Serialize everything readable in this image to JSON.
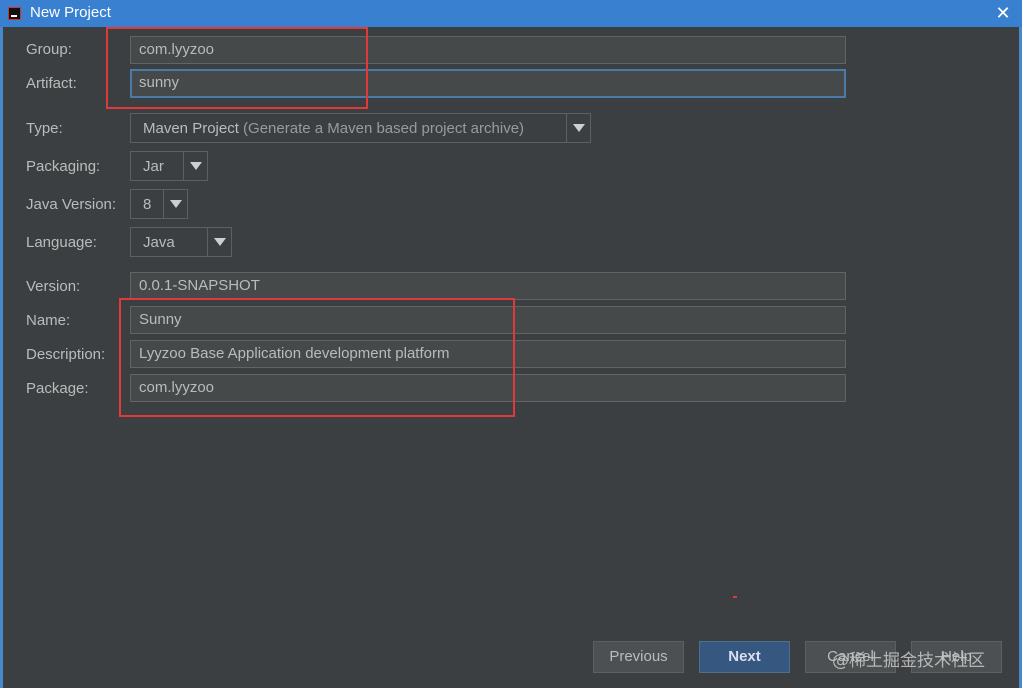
{
  "window": {
    "title": "New Project",
    "close_label": "✕"
  },
  "form": {
    "group": {
      "label": "Group:",
      "value": "com.lyyzoo"
    },
    "artifact": {
      "label": "Artifact:",
      "value": "sunny"
    },
    "type": {
      "label": "Type:",
      "value": "Maven Project",
      "hint": "(Generate a Maven based project archive)"
    },
    "packaging": {
      "label": "Packaging:",
      "value": "Jar"
    },
    "java_version": {
      "label": "Java Version:",
      "value": "8"
    },
    "language": {
      "label": "Language:",
      "value": "Java"
    },
    "version": {
      "label": "Version:",
      "value": "0.0.1-SNAPSHOT"
    },
    "name": {
      "label": "Name:",
      "value": "Sunny"
    },
    "description": {
      "label": "Description:",
      "value": "Lyyzoo Base Application development platform"
    },
    "package": {
      "label": "Package:",
      "value": "com.lyyzoo"
    }
  },
  "buttons": {
    "previous": "Previous",
    "next": "Next",
    "cancel": "Cancel",
    "help": "Help"
  },
  "watermark": "@稀土掘金技术社区",
  "colors": {
    "titlebar": "#3a80d0",
    "background": "#3c3f41",
    "highlight_box": "#e0393a",
    "default_button": "#365880"
  }
}
